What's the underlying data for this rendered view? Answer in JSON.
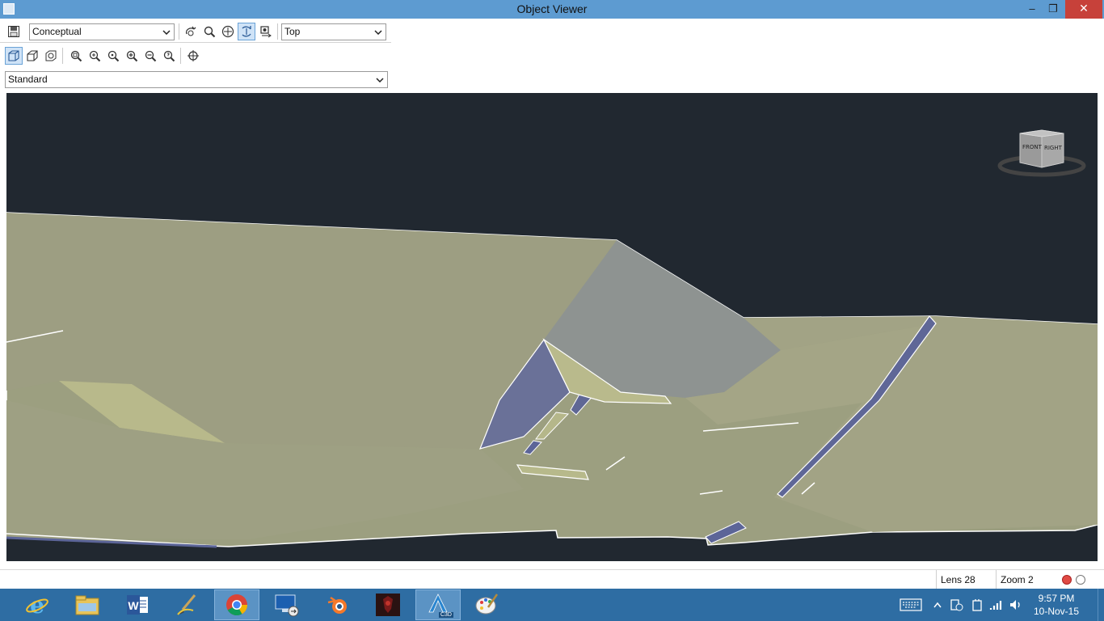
{
  "window": {
    "title": "Object Viewer",
    "minimize_glyph": "–",
    "restore_glyph": "❐",
    "close_glyph": "✕"
  },
  "toolbar": {
    "visual_style": "Conceptual",
    "view": "Top",
    "view_preset": "Standard"
  },
  "viewcube": {
    "front_label": "FRONT",
    "right_label": "RIGHT"
  },
  "status": {
    "lens": "Lens 28",
    "zoom": "Zoom 2"
  },
  "taskbar": {
    "apps": [
      {
        "name": "internet-explorer"
      },
      {
        "name": "file-explorer"
      },
      {
        "name": "microsoft-word"
      },
      {
        "name": "paint-brush-app"
      },
      {
        "name": "google-chrome"
      },
      {
        "name": "remote-desktop"
      },
      {
        "name": "blender"
      },
      {
        "name": "game"
      },
      {
        "name": "autocad-civil-3d"
      },
      {
        "name": "paint"
      }
    ],
    "c3d_label": "C3D",
    "time": "9:57 PM",
    "date": "10-Nov-15"
  },
  "colors": {
    "titlebar": "#5d9bd1",
    "viewport_bg": "#212830",
    "surface": "#9c9f80",
    "surface_light": "#b8b98b",
    "surface_blue": "#6a7198",
    "taskbar": "#2e6da3"
  }
}
